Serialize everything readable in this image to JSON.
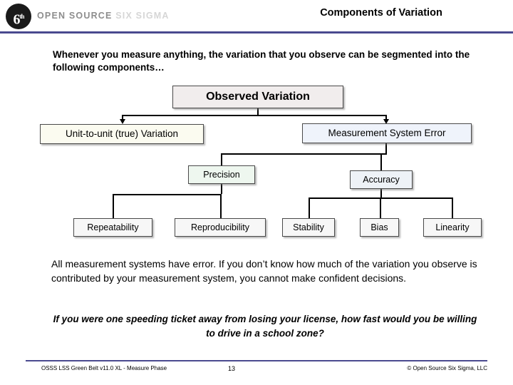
{
  "header": {
    "logo_text": "6",
    "logo_superscript": "th",
    "brand_prefix": "OPEN SOURCE ",
    "brand_accent": "SIX SIGMA",
    "slide_title": "Components of Variation"
  },
  "intro": "Whenever you measure anything, the variation that you observe can be segmented into the following components…",
  "diagram": {
    "observed": "Observed Variation",
    "unit_to_unit": "Unit-to-unit (true) Variation",
    "measurement_system_error": "Measurement System Error",
    "precision": "Precision",
    "accuracy": "Accuracy",
    "repeatability": "Repeatability",
    "reproducibility": "Reproducibility",
    "stability": "Stability",
    "bias": "Bias",
    "linearity": "Linearity"
  },
  "body": {
    "paragraph1": "All measurement systems have error.  If you don’t know how much of the variation you observe is contributed by your measurement system, you cannot make confident decisions.",
    "paragraph2": "If you were one speeding ticket away from losing your license, how fast would you be willing to drive in a school zone?"
  },
  "footer": {
    "left": "OSSS LSS Green Belt v11.0 XL - Measure Phase",
    "page": "13",
    "right": "© Open Source Six Sigma, LLC"
  }
}
